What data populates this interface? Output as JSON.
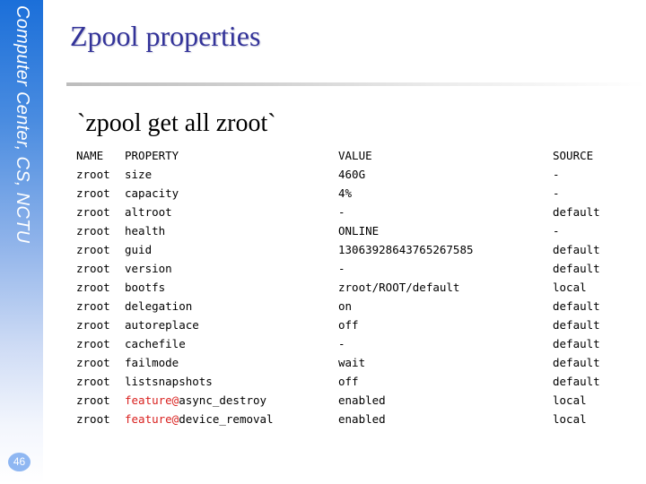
{
  "sidebar": {
    "text": "Computer Center, CS, NCTU",
    "page_number": "46",
    "gradient_top": "#1b6fd9",
    "gradient_bottom": "#ffffff"
  },
  "slide": {
    "title": "Zpool properties",
    "title_color": "#333399",
    "command": "`zpool get all zroot`"
  },
  "table": {
    "headers": {
      "name": "NAME",
      "property": "PROPERTY",
      "value": "VALUE",
      "source": "SOURCE"
    },
    "highlight_color": "#d9211f",
    "rows": [
      {
        "name": "zroot",
        "prefix": "",
        "property": "size",
        "value": "460G",
        "source": "-"
      },
      {
        "name": "zroot",
        "prefix": "",
        "property": "capacity",
        "value": "4%",
        "source": "-"
      },
      {
        "name": "zroot",
        "prefix": "",
        "property": "altroot",
        "value": "-",
        "source": "default"
      },
      {
        "name": "zroot",
        "prefix": "",
        "property": "health",
        "value": "ONLINE",
        "source": "-"
      },
      {
        "name": "zroot",
        "prefix": "",
        "property": "guid",
        "value": "13063928643765267585",
        "source": "default"
      },
      {
        "name": "zroot",
        "prefix": "",
        "property": "version",
        "value": "-",
        "source": "default"
      },
      {
        "name": "zroot",
        "prefix": "",
        "property": "bootfs",
        "value": "zroot/ROOT/default",
        "source": "local"
      },
      {
        "name": "zroot",
        "prefix": "",
        "property": "delegation",
        "value": "on",
        "source": "default"
      },
      {
        "name": "zroot",
        "prefix": "",
        "property": "autoreplace",
        "value": "off",
        "source": "default"
      },
      {
        "name": "zroot",
        "prefix": "",
        "property": "cachefile",
        "value": "-",
        "source": "default"
      },
      {
        "name": "zroot",
        "prefix": "",
        "property": "failmode",
        "value": "wait",
        "source": "default"
      },
      {
        "name": "zroot",
        "prefix": "",
        "property": "listsnapshots",
        "value": "off",
        "source": "default"
      },
      {
        "name": "zroot",
        "prefix": "feature@",
        "property": "async_destroy",
        "value": "enabled",
        "source": "local"
      },
      {
        "name": "zroot",
        "prefix": "feature@",
        "property": "device_removal",
        "value": "enabled",
        "source": "local"
      }
    ]
  }
}
